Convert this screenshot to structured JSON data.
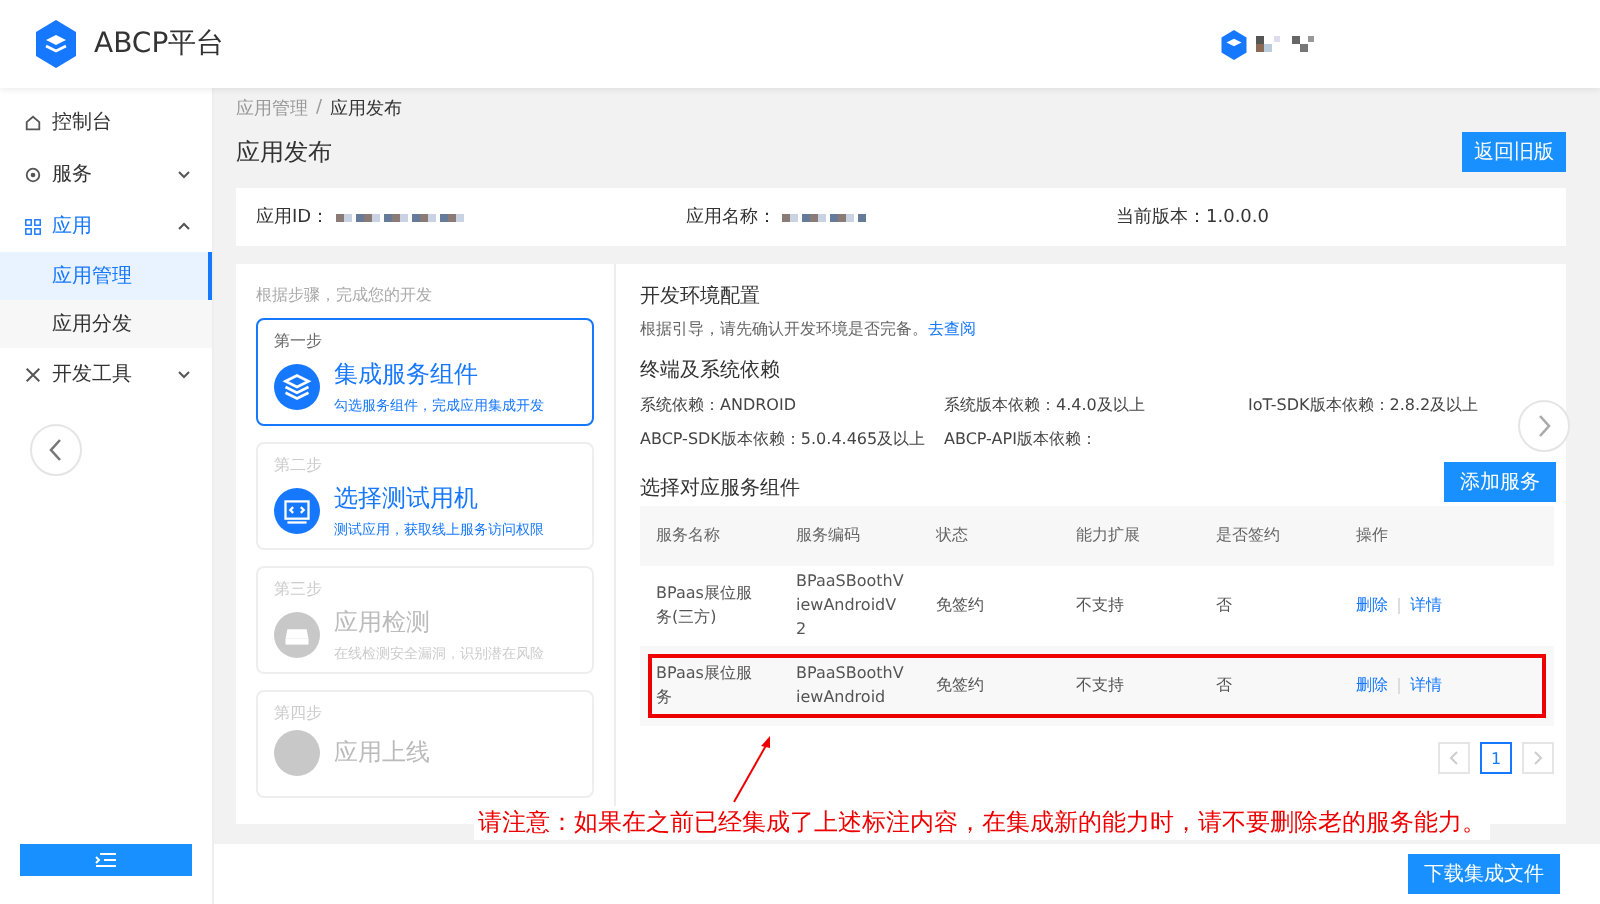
{
  "header": {
    "brand": "ABCP平台"
  },
  "sidebar": {
    "items": [
      {
        "label": "控制台",
        "expanded": false,
        "has_children": false
      },
      {
        "label": "服务",
        "expanded": false,
        "has_children": true
      },
      {
        "label": "应用",
        "expanded": true,
        "has_children": true,
        "children": [
          {
            "label": "应用管理",
            "selected": true
          },
          {
            "label": "应用分发",
            "selected": false
          }
        ]
      },
      {
        "label": "开发工具",
        "expanded": false,
        "has_children": true
      }
    ]
  },
  "breadcrumb": {
    "parent": "应用管理",
    "separator": "/",
    "current": "应用发布"
  },
  "page_title": "应用发布",
  "return_button": "返回旧版",
  "info": {
    "app_id_label": "应用ID：",
    "app_name_label": "应用名称：",
    "version": "当前版本：1.0.0.0"
  },
  "steps_hint": "根据步骤，完成您的开发",
  "steps": [
    {
      "step": "第一步",
      "title": "集成服务组件",
      "desc": "勾选服务组件，完成应用集成开发",
      "selected": true,
      "disabled": false
    },
    {
      "step": "第二步",
      "title": "选择测试用机",
      "desc": "测试应用，获取线上服务访问权限",
      "selected": false,
      "disabled": false
    },
    {
      "step": "第三步",
      "title": "应用检测",
      "desc": "在线检测安全漏洞，识别潜在风险",
      "selected": false,
      "disabled": true
    },
    {
      "step": "第四步",
      "title": "应用上线",
      "selected": false,
      "disabled": true
    }
  ],
  "env": {
    "title": "开发环境配置",
    "text": "根据引导，请先确认开发环境是否完备。",
    "link": "去查阅"
  },
  "deps": {
    "title": "终端及系统依赖",
    "items": [
      "系统依赖：ANDROID",
      "系统版本依赖：4.4.0及以上",
      "IoT-SDK版本依赖：2.8.2及以上",
      "ABCP-SDK版本依赖：5.0.4.465及以上",
      "ABCP-API版本依赖："
    ]
  },
  "services": {
    "title": "选择对应服务组件",
    "add_button": "添加服务",
    "columns": [
      "服务名称",
      "服务编码",
      "状态",
      "能力扩展",
      "是否签约",
      "操作"
    ],
    "rows": [
      {
        "name": "BPaas展位服务(三方)",
        "code": "BPaaSBoothViewAndroidV2",
        "status": "免签约",
        "ability": "不支持",
        "signed": "否",
        "actions": [
          "删除",
          "详情"
        ],
        "highlighted": false
      },
      {
        "name": "BPaas展位服务",
        "code": "BPaaSBoothViewAndroid",
        "status": "免签约",
        "ability": "不支持",
        "signed": "否",
        "actions": [
          "删除",
          "详情"
        ],
        "highlighted": true
      }
    ]
  },
  "pagination": {
    "pages": [
      {
        "label": "1",
        "selected": true
      }
    ]
  },
  "annotation": "请注意：如果在之前已经集成了上述标注内容，在集成新的能力时，请不要删除老的服务能力。",
  "download_button": "下载集成文件"
}
